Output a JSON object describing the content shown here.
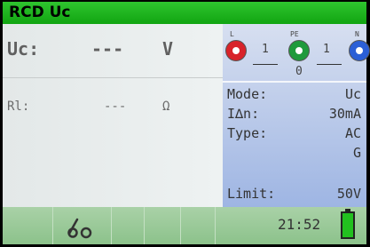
{
  "title": "RCD Uc",
  "measurement": {
    "uc_label": "Uc:",
    "uc_value": "---",
    "uc_unit": "V",
    "rl_label": "Rl:",
    "rl_value": "---",
    "rl_unit": "Ω"
  },
  "terminals": {
    "l": {
      "label": "L",
      "color": "#d8232a"
    },
    "pe": {
      "label": "PE",
      "color": "#1f9a3c"
    },
    "n": {
      "label": "N",
      "color": "#2b5fd6"
    },
    "l_pe": "1",
    "pe_n": "1",
    "l_n": "0"
  },
  "settings": {
    "mode_label": "Mode:",
    "mode_value": "Uc",
    "in_label": "I∆n:",
    "in_value": "30mA",
    "type_label": "Type:",
    "type_value": "AC",
    "type_value2": "G",
    "limit_label": "Limit:",
    "limit_value": "50V"
  },
  "footer": {
    "clock": "21:52",
    "probe_icon": "probe-icon",
    "battery_icon": "battery-icon"
  }
}
